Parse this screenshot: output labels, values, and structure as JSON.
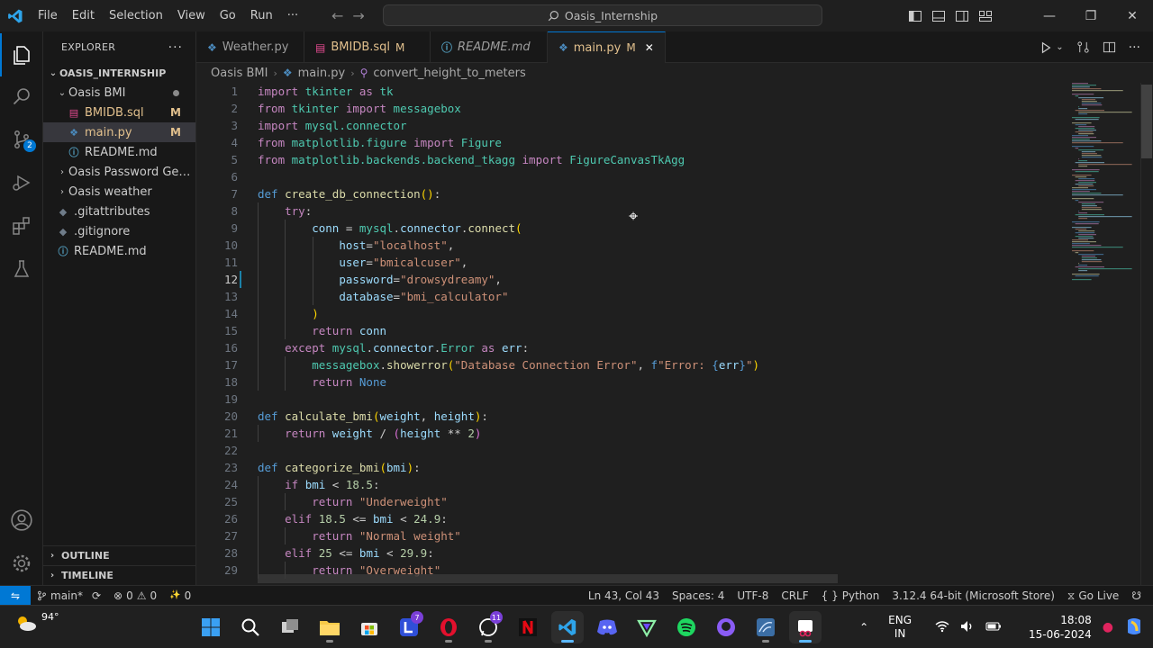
{
  "menu": [
    "File",
    "Edit",
    "Selection",
    "View",
    "Go",
    "Run",
    "···"
  ],
  "command_center": "Oasis_Internship",
  "explorer": {
    "header": "EXPLORER",
    "root": "OASIS_INTERNSHIP",
    "items": [
      {
        "label": "Oasis BMI",
        "type": "folder-open",
        "indent": 1
      },
      {
        "label": "BMIDB.sql",
        "type": "sql",
        "indent": 2,
        "status": "M"
      },
      {
        "label": "main.py",
        "type": "py",
        "indent": 2,
        "status": "M",
        "selected": true
      },
      {
        "label": "README.md",
        "type": "md",
        "indent": 2
      },
      {
        "label": "Oasis Password Gene...",
        "type": "folder",
        "indent": 1
      },
      {
        "label": "Oasis weather",
        "type": "folder",
        "indent": 1
      },
      {
        "label": ".gitattributes",
        "type": "git",
        "indent": 1
      },
      {
        "label": ".gitignore",
        "type": "git",
        "indent": 1
      },
      {
        "label": "README.md",
        "type": "md",
        "indent": 1
      }
    ],
    "outline": "OUTLINE",
    "timeline": "TIMELINE"
  },
  "tabs": [
    {
      "label": "Weather.py",
      "icon": "py"
    },
    {
      "label": "BMIDB.sql",
      "icon": "sql",
      "status": "M"
    },
    {
      "label": "README.md",
      "icon": "md",
      "italic": true
    },
    {
      "label": "main.py",
      "icon": "py",
      "status": "M",
      "active": true
    }
  ],
  "breadcrumb": [
    "Oasis BMI",
    "main.py",
    "convert_height_to_meters"
  ],
  "scm_badge": "2",
  "code": {
    "current_line": 12,
    "modified_lines": [
      12
    ],
    "lines": [
      [
        [
          "kw",
          "import"
        ],
        [
          "t",
          " "
        ],
        [
          "cls",
          "tkinter"
        ],
        [
          "t",
          " "
        ],
        [
          "kw",
          "as"
        ],
        [
          "t",
          " "
        ],
        [
          "cls",
          "tk"
        ]
      ],
      [
        [
          "kw",
          "from"
        ],
        [
          "t",
          " "
        ],
        [
          "cls",
          "tkinter"
        ],
        [
          "t",
          " "
        ],
        [
          "kw",
          "import"
        ],
        [
          "t",
          " "
        ],
        [
          "cls",
          "messagebox"
        ]
      ],
      [
        [
          "kw",
          "import"
        ],
        [
          "t",
          " "
        ],
        [
          "cls",
          "mysql.connector"
        ]
      ],
      [
        [
          "kw",
          "from"
        ],
        [
          "t",
          " "
        ],
        [
          "cls",
          "matplotlib.figure"
        ],
        [
          "t",
          " "
        ],
        [
          "kw",
          "import"
        ],
        [
          "t",
          " "
        ],
        [
          "cls",
          "Figure"
        ]
      ],
      [
        [
          "kw",
          "from"
        ],
        [
          "t",
          " "
        ],
        [
          "cls",
          "matplotlib.backends.backend_tkagg"
        ],
        [
          "t",
          " "
        ],
        [
          "kw",
          "import"
        ],
        [
          "t",
          " "
        ],
        [
          "cls",
          "FigureCanvasTkAgg"
        ]
      ],
      [],
      [
        [
          "def",
          "def"
        ],
        [
          "t",
          " "
        ],
        [
          "fn",
          "create_db_connection"
        ],
        [
          "par",
          "()"
        ],
        [
          "t",
          ":"
        ]
      ],
      [
        [
          "t",
          "    "
        ],
        [
          "kw",
          "try"
        ],
        [
          "t",
          ":"
        ]
      ],
      [
        [
          "t",
          "        "
        ],
        [
          "var",
          "conn"
        ],
        [
          "t",
          " = "
        ],
        [
          "cls",
          "mysql"
        ],
        [
          "t",
          "."
        ],
        [
          "var",
          "connector"
        ],
        [
          "t",
          "."
        ],
        [
          "fn",
          "connect"
        ],
        [
          "par",
          "("
        ]
      ],
      [
        [
          "t",
          "            "
        ],
        [
          "var",
          "host"
        ],
        [
          "t",
          "="
        ],
        [
          "str",
          "\"localhost\""
        ],
        [
          "t",
          ","
        ]
      ],
      [
        [
          "t",
          "            "
        ],
        [
          "var",
          "user"
        ],
        [
          "t",
          "="
        ],
        [
          "str",
          "\"bmicalcuser\""
        ],
        [
          "t",
          ","
        ]
      ],
      [
        [
          "t",
          "            "
        ],
        [
          "var",
          "password"
        ],
        [
          "t",
          "="
        ],
        [
          "str",
          "\"drowsydreamy\""
        ],
        [
          "t",
          ","
        ]
      ],
      [
        [
          "t",
          "            "
        ],
        [
          "var",
          "database"
        ],
        [
          "t",
          "="
        ],
        [
          "str",
          "\"bmi_calculator\""
        ]
      ],
      [
        [
          "t",
          "        "
        ],
        [
          "par",
          ")"
        ]
      ],
      [
        [
          "t",
          "        "
        ],
        [
          "kw",
          "return"
        ],
        [
          "t",
          " "
        ],
        [
          "var",
          "conn"
        ]
      ],
      [
        [
          "t",
          "    "
        ],
        [
          "kw",
          "except"
        ],
        [
          "t",
          " "
        ],
        [
          "cls",
          "mysql"
        ],
        [
          "t",
          "."
        ],
        [
          "var",
          "connector"
        ],
        [
          "t",
          "."
        ],
        [
          "cls",
          "Error"
        ],
        [
          "t",
          " "
        ],
        [
          "kw",
          "as"
        ],
        [
          "t",
          " "
        ],
        [
          "var",
          "err"
        ],
        [
          "t",
          ":"
        ]
      ],
      [
        [
          "t",
          "        "
        ],
        [
          "cls",
          "messagebox"
        ],
        [
          "t",
          "."
        ],
        [
          "fn",
          "showerror"
        ],
        [
          "par",
          "("
        ],
        [
          "str",
          "\"Database Connection Error\""
        ],
        [
          "t",
          ", "
        ],
        [
          "def",
          "f"
        ],
        [
          "str",
          "\"Error: "
        ],
        [
          "def",
          "{"
        ],
        [
          "var",
          "err"
        ],
        [
          "def",
          "}"
        ],
        [
          "str",
          "\""
        ],
        [
          "par",
          ")"
        ]
      ],
      [
        [
          "t",
          "        "
        ],
        [
          "kw",
          "return"
        ],
        [
          "t",
          " "
        ],
        [
          "def",
          "None"
        ]
      ],
      [],
      [
        [
          "def",
          "def"
        ],
        [
          "t",
          " "
        ],
        [
          "fn",
          "calculate_bmi"
        ],
        [
          "par",
          "("
        ],
        [
          "var",
          "weight"
        ],
        [
          "t",
          ", "
        ],
        [
          "var",
          "height"
        ],
        [
          "par",
          ")"
        ],
        [
          "t",
          ":"
        ]
      ],
      [
        [
          "t",
          "    "
        ],
        [
          "kw",
          "return"
        ],
        [
          "t",
          " "
        ],
        [
          "var",
          "weight"
        ],
        [
          "t",
          " / "
        ],
        [
          "par2",
          "("
        ],
        [
          "var",
          "height"
        ],
        [
          "t",
          " ** "
        ],
        [
          "num",
          "2"
        ],
        [
          "par2",
          ")"
        ]
      ],
      [],
      [
        [
          "def",
          "def"
        ],
        [
          "t",
          " "
        ],
        [
          "fn",
          "categorize_bmi"
        ],
        [
          "par",
          "("
        ],
        [
          "var",
          "bmi"
        ],
        [
          "par",
          ")"
        ],
        [
          "t",
          ":"
        ]
      ],
      [
        [
          "t",
          "    "
        ],
        [
          "kw",
          "if"
        ],
        [
          "t",
          " "
        ],
        [
          "var",
          "bmi"
        ],
        [
          "t",
          " < "
        ],
        [
          "num",
          "18.5"
        ],
        [
          "t",
          ":"
        ]
      ],
      [
        [
          "t",
          "        "
        ],
        [
          "kw",
          "return"
        ],
        [
          "t",
          " "
        ],
        [
          "str",
          "\"Underweight\""
        ]
      ],
      [
        [
          "t",
          "    "
        ],
        [
          "kw",
          "elif"
        ],
        [
          "t",
          " "
        ],
        [
          "num",
          "18.5"
        ],
        [
          "t",
          " <= "
        ],
        [
          "var",
          "bmi"
        ],
        [
          "t",
          " < "
        ],
        [
          "num",
          "24.9"
        ],
        [
          "t",
          ":"
        ]
      ],
      [
        [
          "t",
          "        "
        ],
        [
          "kw",
          "return"
        ],
        [
          "t",
          " "
        ],
        [
          "str",
          "\"Normal weight\""
        ]
      ],
      [
        [
          "t",
          "    "
        ],
        [
          "kw",
          "elif"
        ],
        [
          "t",
          " "
        ],
        [
          "num",
          "25"
        ],
        [
          "t",
          " <= "
        ],
        [
          "var",
          "bmi"
        ],
        [
          "t",
          " < "
        ],
        [
          "num",
          "29.9"
        ],
        [
          "t",
          ":"
        ]
      ],
      [
        [
          "t",
          "        "
        ],
        [
          "kw",
          "return"
        ],
        [
          "t",
          " "
        ],
        [
          "str",
          "\"Overweight\""
        ]
      ]
    ]
  },
  "status": {
    "branch": "main*",
    "errors": "0",
    "warnings": "0",
    "ports": "0",
    "position": "Ln 43, Col 43",
    "spaces": "Spaces: 4",
    "encoding": "UTF-8",
    "eol": "CRLF",
    "language": "Python",
    "interpreter": "3.12.4 64-bit (Microsoft Store)",
    "golive": "Go Live"
  },
  "taskbar": {
    "temperature": "94°",
    "lang_top": "ENG",
    "lang_bottom": "IN",
    "time": "18:08",
    "date": "15-06-2024",
    "badge_l": "7",
    "badge_wa": "11"
  },
  "colors": {
    "accent": "#0078d4",
    "modified": "#e2c08d",
    "editor_bg": "#1f1f1f"
  }
}
